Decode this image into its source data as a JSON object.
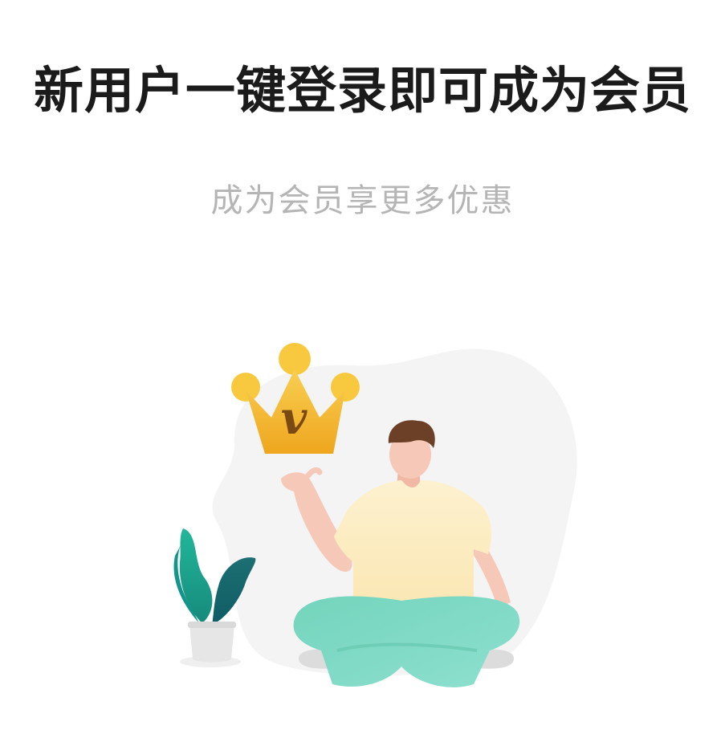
{
  "header": {
    "title": "新用户一键登录即可成为会员",
    "subtitle": "成为会员享更多优惠"
  },
  "illustration": {
    "crown_letter": "v",
    "icons": [
      "crown-icon",
      "plant-icon",
      "person-illustration"
    ]
  },
  "colors": {
    "title": "#1b1b1b",
    "subtitle": "#b5b5b5",
    "crown": "#f3b62f",
    "shirt": "#fbecc1",
    "pants": "#6fcfb5",
    "leaf": "#1ea58f"
  }
}
